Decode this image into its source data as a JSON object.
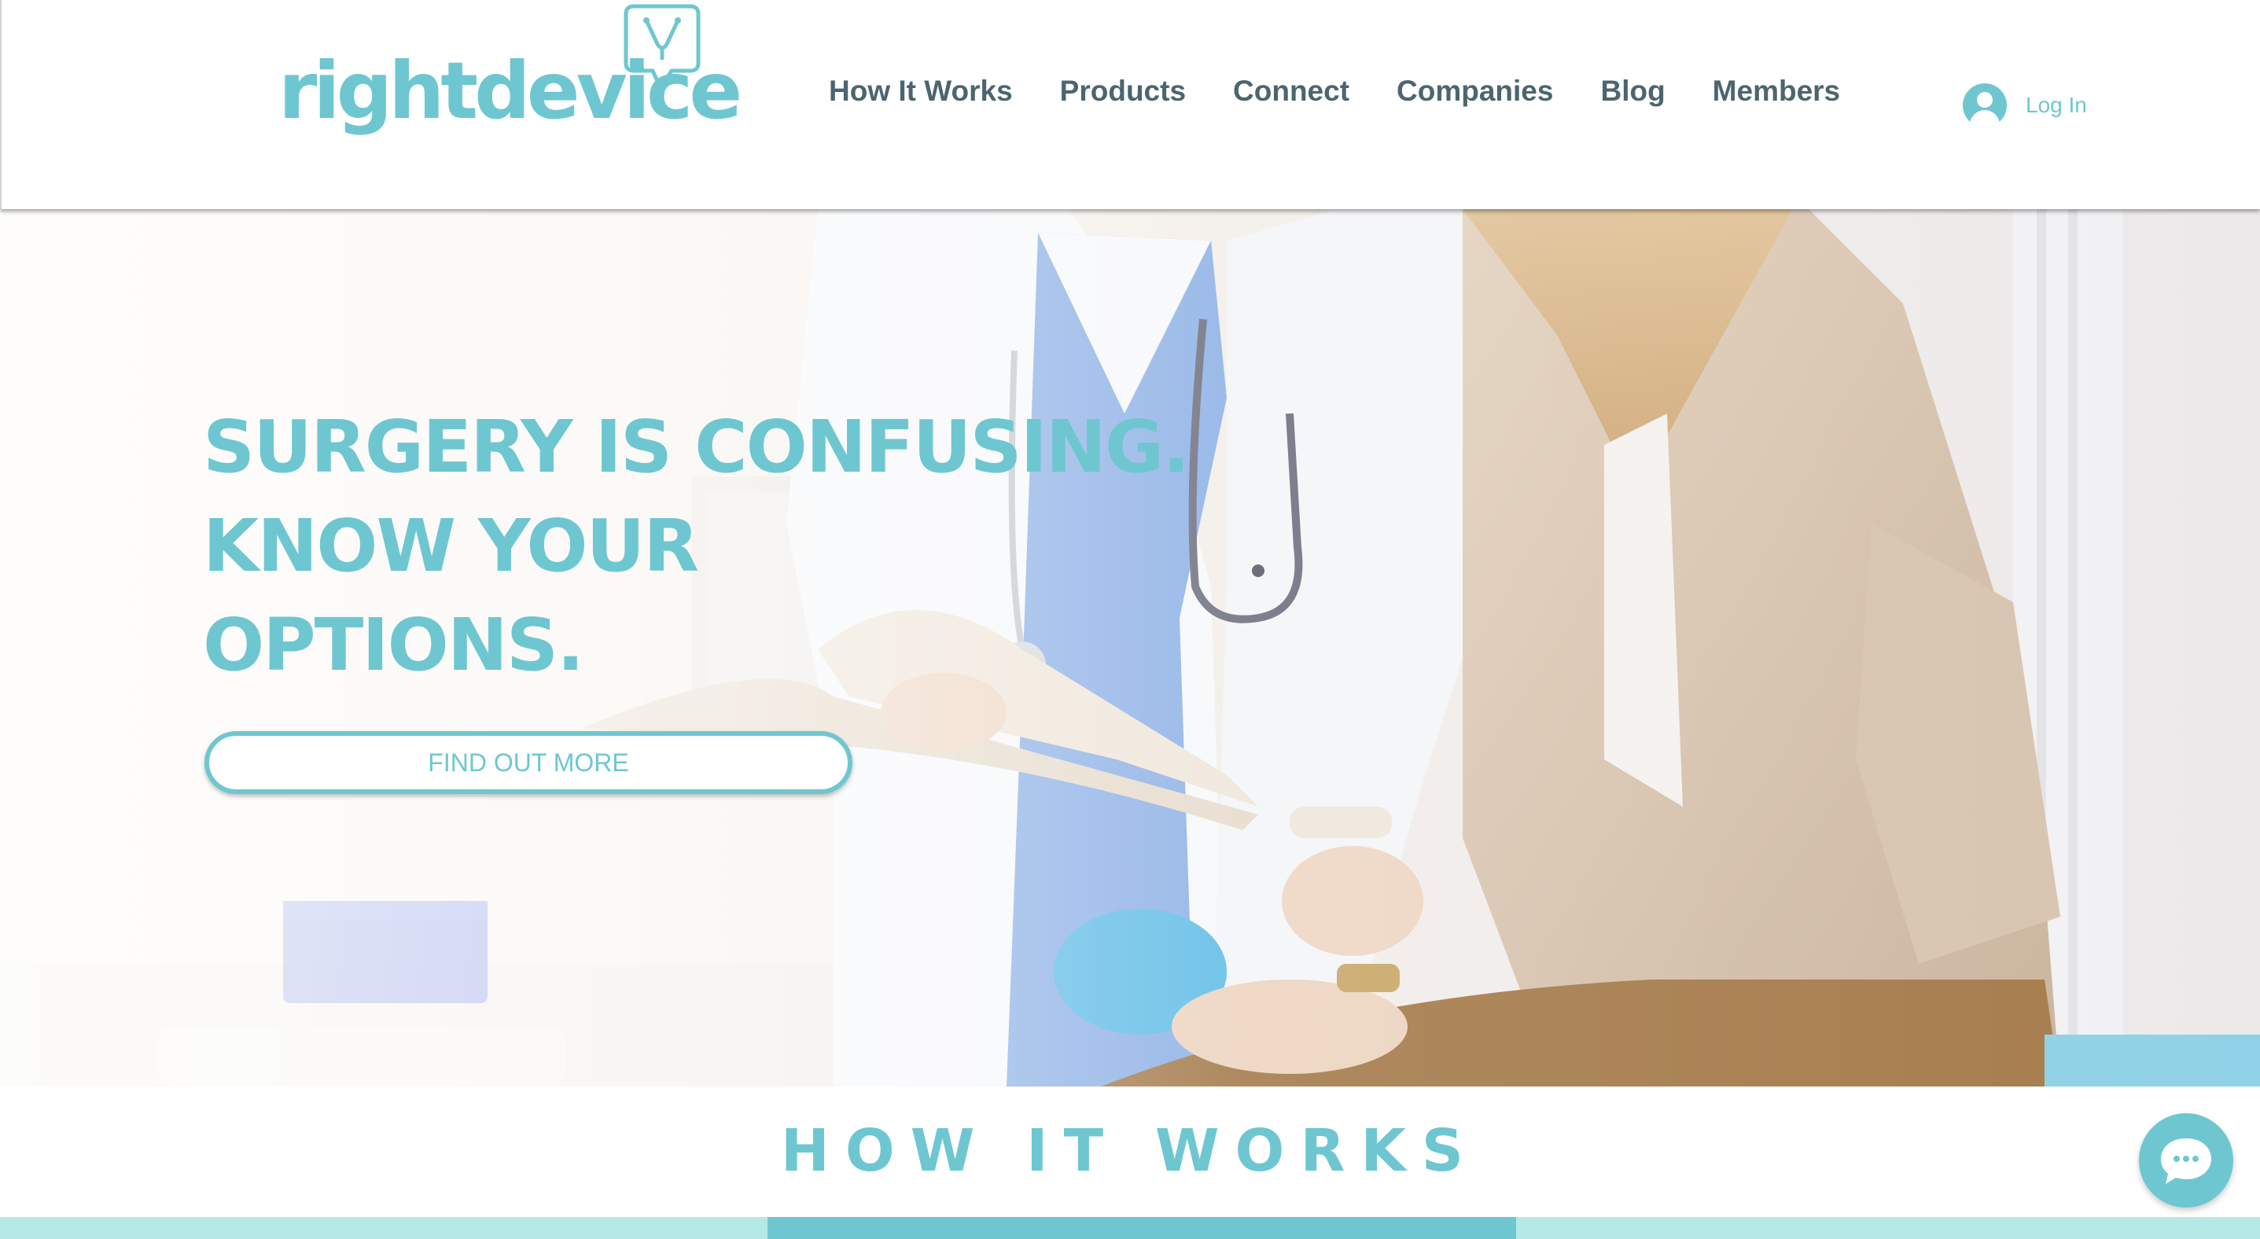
{
  "brand": {
    "name": "rightdevice",
    "color": "#6ec7d0"
  },
  "nav": {
    "items": [
      {
        "label": "How It Works"
      },
      {
        "label": "Products"
      },
      {
        "label": "Connect"
      },
      {
        "label": "Companies"
      },
      {
        "label": "Blog"
      },
      {
        "label": "Members"
      }
    ]
  },
  "login": {
    "label": "Log In",
    "icon": "user-avatar-icon"
  },
  "hero": {
    "title_lines": [
      "SURGERY IS CONFUSING.",
      "KNOW YOUR",
      "OPTIONS."
    ],
    "cta_label": "FIND OUT MORE",
    "image": "doctor-with-patient-photo"
  },
  "section": {
    "title": "HOW IT WORKS"
  },
  "chat": {
    "icon": "chat-bubble-icon"
  },
  "colors": {
    "accent": "#6ec7d0",
    "nav_text": "#4c6570",
    "light_teal": "#b6e9e6"
  }
}
